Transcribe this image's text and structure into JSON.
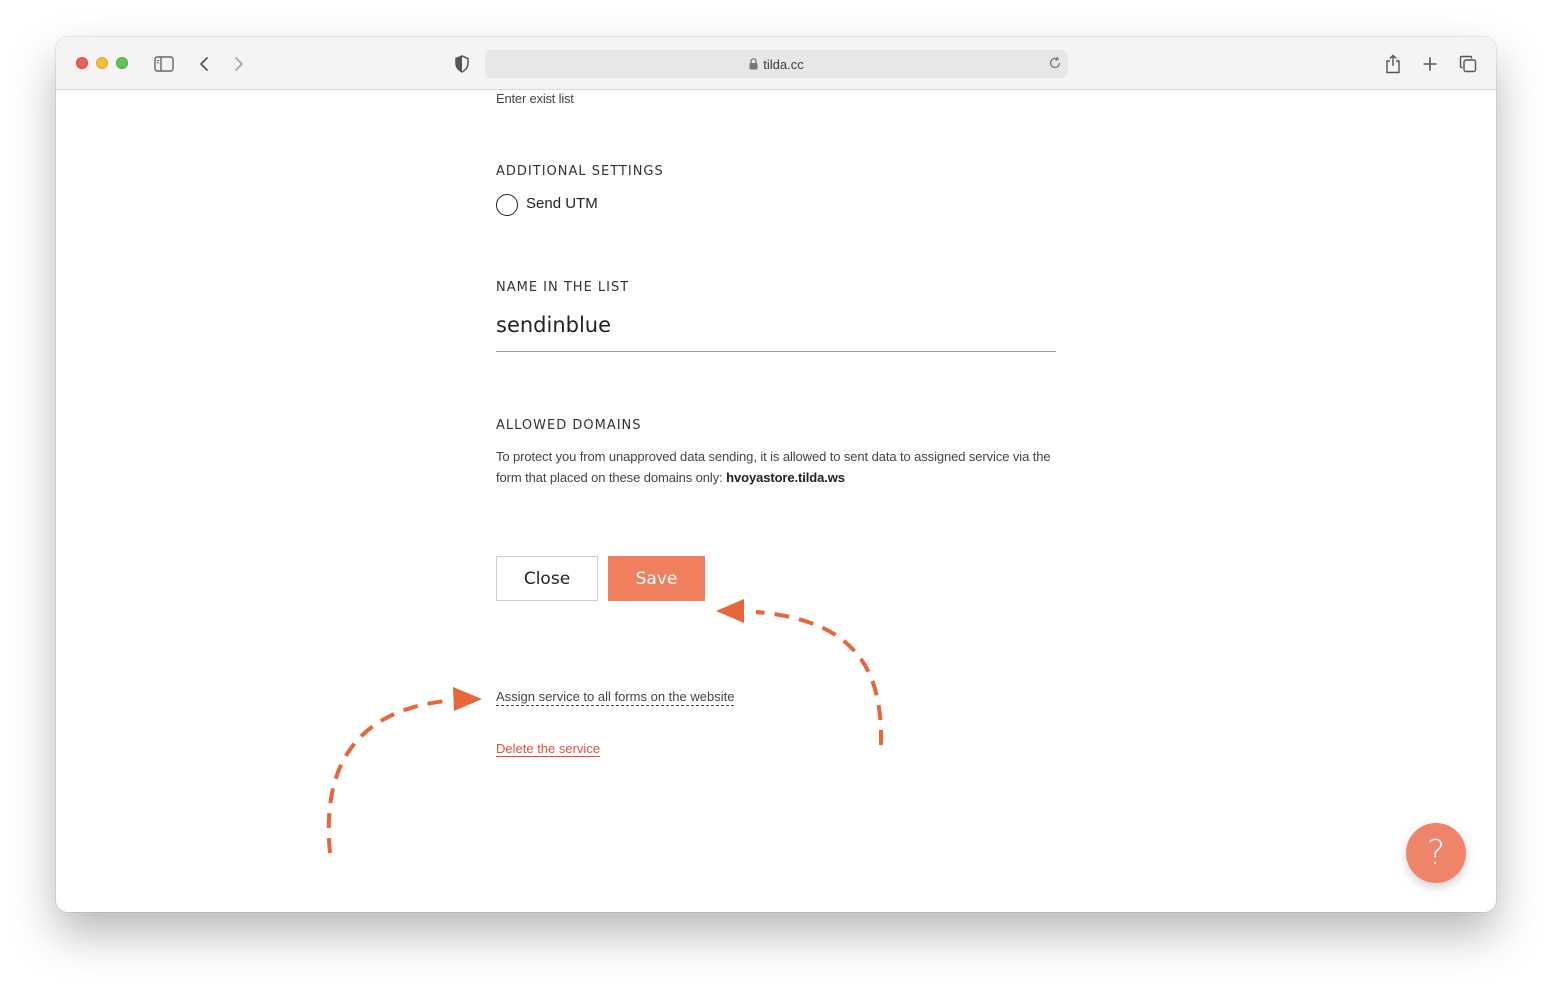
{
  "browser": {
    "url": "tilda.cc"
  },
  "form": {
    "list_hint": "Enter exist list",
    "additional_settings_label": "ADDITIONAL SETTINGS",
    "send_utm_label": "Send UTM",
    "name_in_list_label": "NAME IN THE LIST",
    "name_in_list_value": "sendinblue",
    "allowed_domains_label": "ALLOWED DOMAINS",
    "allowed_domains_text": "To protect you from unapproved data sending, it is allowed to sent data to assigned service via the form that placed on these domains only: ",
    "allowed_domain": "hvoyastore.tilda.ws",
    "close_label": "Close",
    "save_label": "Save",
    "assign_link": "Assign service to all forms on the website",
    "delete_link": "Delete the service"
  },
  "help": {
    "label": "?"
  },
  "colors": {
    "accent": "#f0805d",
    "danger": "#e14f3c",
    "annotation": "#e8673a"
  }
}
